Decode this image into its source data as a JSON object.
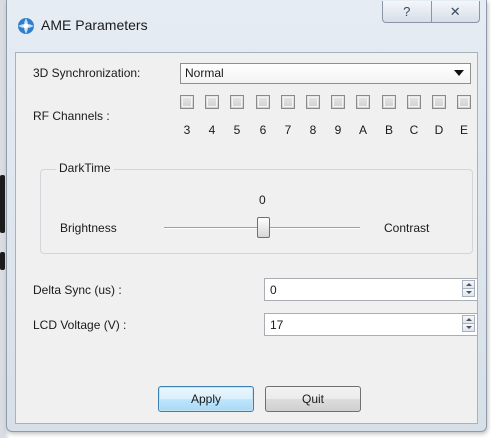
{
  "window": {
    "title": "AME Parameters",
    "help_glyph": "?",
    "close_glyph": "✕"
  },
  "sync": {
    "label": "3D Synchronization:",
    "selected": "Normal"
  },
  "rf": {
    "label": "RF Channels :",
    "channels": [
      "3",
      "4",
      "5",
      "6",
      "7",
      "8",
      "9",
      "A",
      "B",
      "C",
      "D",
      "E"
    ]
  },
  "darktime": {
    "group_label": "DarkTime",
    "value": "0",
    "left_label": "Brightness",
    "right_label": "Contrast",
    "slider_fraction": 0.5
  },
  "delta_sync": {
    "label": "Delta Sync (us) :",
    "value": "0"
  },
  "lcd_voltage": {
    "label": "LCD Voltage (V) :",
    "value": "17"
  },
  "buttons": {
    "apply": "Apply",
    "quit": "Quit"
  },
  "colors": {
    "accent": "#3c7fb1",
    "titlebar": "#dbe4ee"
  }
}
